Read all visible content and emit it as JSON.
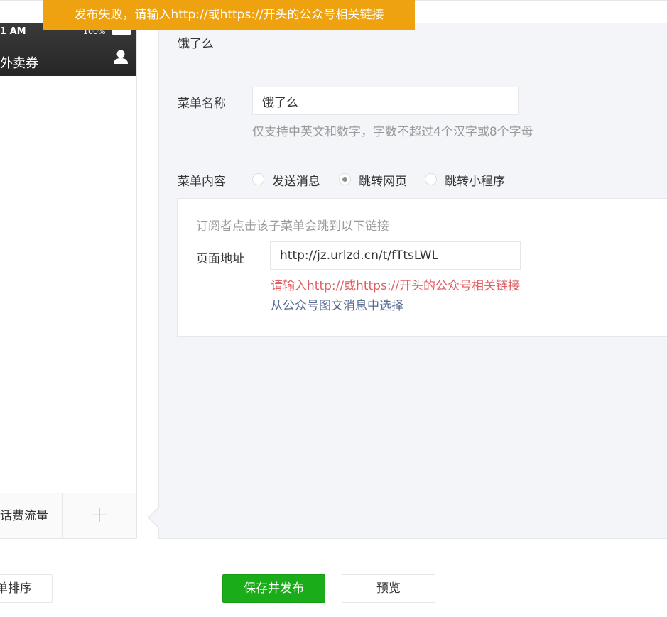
{
  "toast": {
    "message": "发布失败，请输入http://或https://开头的公众号相关链接"
  },
  "phone": {
    "status_time": "1 AM",
    "status_battery": "100%",
    "title": "外卖券",
    "menu": [
      {
        "label": "话费流量"
      },
      {
        "label": "+"
      }
    ]
  },
  "editor": {
    "title": "饿了么",
    "menu_name": {
      "label": "菜单名称",
      "value": "饿了么",
      "tip": "仅支持中英文和数字，字数不超过4个汉字或8个字母"
    },
    "menu_content": {
      "label": "菜单内容",
      "options": [
        {
          "label": "发送消息",
          "checked": false
        },
        {
          "label": "跳转网页",
          "checked": true
        },
        {
          "label": "跳转小程序",
          "checked": false
        }
      ]
    },
    "url_section": {
      "description": "订阅者点击该子菜单会跳到以下链接",
      "label": "页面地址",
      "value": "http://jz.urlzd.cn/t/fTtsLWL",
      "error": "请输入http://或https://开头的公众号相关链接",
      "pick_link": "从公众号图文消息中选择"
    }
  },
  "buttons": {
    "sort": "单排序",
    "publish": "保存并发布",
    "preview": "预览"
  },
  "colors": {
    "toast": "#eea20f",
    "publish": "#1aad19",
    "error": "#e15f63",
    "link": "#576b95"
  }
}
